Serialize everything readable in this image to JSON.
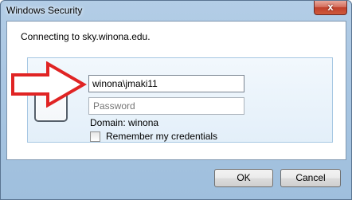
{
  "window": {
    "title": "Windows Security",
    "close_label": "x"
  },
  "dialog": {
    "connecting_text": "Connecting to sky.winona.edu."
  },
  "credentials": {
    "username_value": "winona\\jmaki11",
    "password_placeholder": "Password",
    "domain_text": "Domain: winona",
    "remember_label": "Remember my credentials",
    "remember_checked": false
  },
  "buttons": {
    "ok_label": "OK",
    "cancel_label": "Cancel"
  },
  "icons": {
    "close": "close-icon",
    "user_tile": "user-tile-icon",
    "annotation_arrow": "red-arrow-icon"
  },
  "colors": {
    "arrow": "#e02424",
    "close_button": "#c84a34",
    "title_bar": "#a9c6e2"
  }
}
